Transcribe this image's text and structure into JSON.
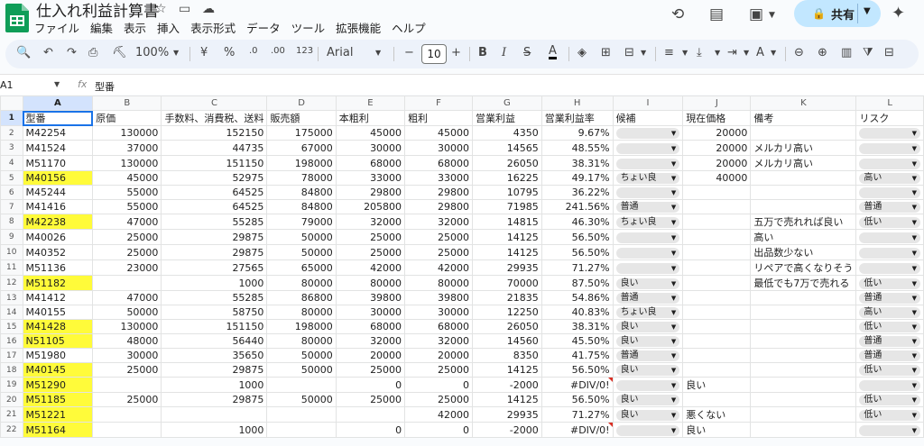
{
  "header": {
    "title": "仕入れ利益計算書",
    "menus": [
      "ファイル",
      "編集",
      "表示",
      "挿入",
      "表示形式",
      "データ",
      "ツール",
      "拡張機能",
      "ヘルプ"
    ],
    "share_label": "共有"
  },
  "toolbar": {
    "zoom": "100%",
    "currency": "¥",
    "percent": "%",
    "dec_decrease": ".0",
    "dec_increase": ".00",
    "number_format": "123",
    "font": "Arial",
    "font_size": "10"
  },
  "formula_bar": {
    "cell_ref": "A1",
    "content": "型番"
  },
  "columns": [
    "A",
    "B",
    "C",
    "D",
    "E",
    "F",
    "G",
    "H",
    "I",
    "J",
    "K",
    "L"
  ],
  "header_row": [
    "型番",
    "原価",
    "手数料、消費税、送料",
    "販売額",
    "本粗利",
    "粗利",
    "営業利益",
    "営業利益率",
    "候補",
    "現在価格",
    "備考",
    "リスク"
  ],
  "rows": [
    {
      "n": "2",
      "c": [
        "M42254",
        "130000",
        "152150",
        "175000",
        "45000",
        "45000",
        "4350",
        "9.67%",
        "",
        "20000",
        "",
        ""
      ]
    },
    {
      "n": "3",
      "c": [
        "M41524",
        "37000",
        "44735",
        "67000",
        "30000",
        "30000",
        "14565",
        "48.55%",
        "",
        "20000",
        "メルカリ高い",
        ""
      ]
    },
    {
      "n": "4",
      "c": [
        "M51170",
        "130000",
        "151150",
        "198000",
        "68000",
        "68000",
        "26050",
        "38.31%",
        "",
        "20000",
        "メルカリ高い",
        ""
      ]
    },
    {
      "n": "5",
      "c": [
        "M40156",
        "45000",
        "52975",
        "78000",
        "33000",
        "33000",
        "16225",
        "49.17%",
        "ちょい良",
        "40000",
        "",
        "高い"
      ]
    },
    {
      "n": "6",
      "c": [
        "M45244",
        "55000",
        "64525",
        "84800",
        "29800",
        "29800",
        "10795",
        "36.22%",
        "",
        "",
        "",
        ""
      ]
    },
    {
      "n": "7",
      "c": [
        "M41416",
        "55000",
        "64525",
        "84800",
        "205800",
        "29800",
        "71985",
        "241.56%",
        "普通",
        "",
        "",
        "普通"
      ]
    },
    {
      "n": "8",
      "c": [
        "M42238",
        "47000",
        "55285",
        "79000",
        "32000",
        "32000",
        "14815",
        "46.30%",
        "ちょい良",
        "",
        "五万で売れれば良い",
        "低い"
      ]
    },
    {
      "n": "9",
      "c": [
        "M40026",
        "25000",
        "29875",
        "50000",
        "25000",
        "25000",
        "14125",
        "56.50%",
        "",
        "",
        "高い",
        ""
      ]
    },
    {
      "n": "10",
      "c": [
        "M40352",
        "25000",
        "29875",
        "50000",
        "25000",
        "25000",
        "14125",
        "56.50%",
        "",
        "",
        "出品数少ない",
        ""
      ]
    },
    {
      "n": "11",
      "c": [
        "M51136",
        "23000",
        "27565",
        "65000",
        "42000",
        "42000",
        "29935",
        "71.27%",
        "",
        "",
        "リペアで高くなりそう",
        ""
      ]
    },
    {
      "n": "12",
      "c": [
        "M51182",
        "",
        "1000",
        "80000",
        "80000",
        "80000",
        "70000",
        "87.50%",
        "良い",
        "",
        "最低でも7万で売れる",
        "低い"
      ]
    },
    {
      "n": "13",
      "c": [
        "M41412",
        "47000",
        "55285",
        "86800",
        "39800",
        "39800",
        "21835",
        "54.86%",
        "普通",
        "",
        "",
        "普通"
      ]
    },
    {
      "n": "14",
      "c": [
        "M40155",
        "50000",
        "58750",
        "80000",
        "30000",
        "30000",
        "12250",
        "40.83%",
        "ちょい良",
        "",
        "",
        "高い"
      ]
    },
    {
      "n": "15",
      "c": [
        "M41428",
        "130000",
        "151150",
        "198000",
        "68000",
        "68000",
        "26050",
        "38.31%",
        "良い",
        "",
        "",
        "低い"
      ]
    },
    {
      "n": "16",
      "c": [
        "N51105",
        "48000",
        "56440",
        "80000",
        "32000",
        "32000",
        "14560",
        "45.50%",
        "良い",
        "",
        "",
        "普通"
      ]
    },
    {
      "n": "17",
      "c": [
        "M51980",
        "30000",
        "35650",
        "50000",
        "20000",
        "20000",
        "8350",
        "41.75%",
        "普通",
        "",
        "",
        "普通"
      ]
    },
    {
      "n": "18",
      "c": [
        "M40145",
        "25000",
        "29875",
        "50000",
        "25000",
        "25000",
        "14125",
        "56.50%",
        "良い",
        "",
        "",
        "低い"
      ]
    },
    {
      "n": "19",
      "c": [
        "M51290",
        "",
        "1000",
        "",
        "0",
        "0",
        "-2000",
        "#DIV/0!",
        "",
        "良い",
        "",
        ""
      ]
    },
    {
      "n": "20",
      "c": [
        "M51185",
        "25000",
        "29875",
        "50000",
        "25000",
        "25000",
        "14125",
        "56.50%",
        "良い",
        "",
        "",
        "低い"
      ]
    },
    {
      "n": "21",
      "c": [
        "M51221",
        "",
        "",
        "",
        "",
        "42000",
        "29935",
        "71.27%",
        "良い",
        "悪くない",
        "",
        "低い"
      ]
    },
    {
      "n": "22",
      "c": [
        "M51164",
        "",
        "1000",
        "",
        "0",
        "0",
        "-2000",
        "#DIV/0!",
        "",
        "良い",
        "",
        ""
      ]
    }
  ],
  "highlight_rows": [
    "5",
    "8",
    "12",
    "15",
    "16",
    "18",
    "19",
    "20",
    "21",
    "22"
  ],
  "dropdown_rows": [
    "2",
    "3",
    "4",
    "5",
    "6",
    "7",
    "8",
    "9",
    "10",
    "11",
    "12",
    "13",
    "14",
    "15",
    "16",
    "17",
    "18",
    "19",
    "20",
    "21",
    "22"
  ],
  "colors": {
    "highlight": "#fffb3a",
    "share": "#c2e7ff",
    "selection": "#1a73e8"
  }
}
